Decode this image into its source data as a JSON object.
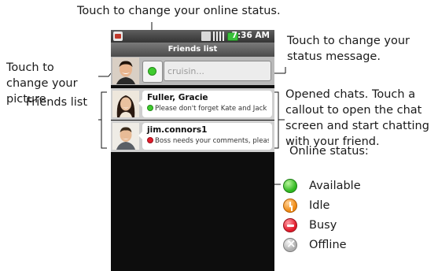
{
  "annotations": {
    "online_status": "Touch to change your online status.",
    "picture": [
      "Touch to",
      "change your",
      "picture"
    ],
    "status_message": [
      "Touch to change your",
      "status message."
    ],
    "friends_list": "Friends list",
    "opened_chats": [
      "Opened chats. Touch a",
      "callout to open the chat",
      "screen and start chatting",
      "with your friend."
    ]
  },
  "phone": {
    "clock": "7:36 AM",
    "title": "Friends list",
    "status_message_placeholder": "cruisin...",
    "friends": [
      {
        "name": "Fuller, Gracie",
        "message": "Please don't forget Kate and Jack",
        "status": "available"
      },
      {
        "name": "jim.connors1",
        "message": "Boss needs your comments, please",
        "status": "busy"
      }
    ]
  },
  "legend": {
    "title": "Online status:",
    "items": [
      {
        "key": "available",
        "label": "Available",
        "color": "#2fb81f",
        "icon": "available-icon"
      },
      {
        "key": "idle",
        "label": "Idle",
        "color": "#f08a12",
        "icon": "idle-icon"
      },
      {
        "key": "busy",
        "label": "Busy",
        "color": "#e21b2b",
        "icon": "busy-icon"
      },
      {
        "key": "offline",
        "label": "Offline",
        "color": "#aeaeae",
        "icon": "offline-icon"
      }
    ]
  }
}
